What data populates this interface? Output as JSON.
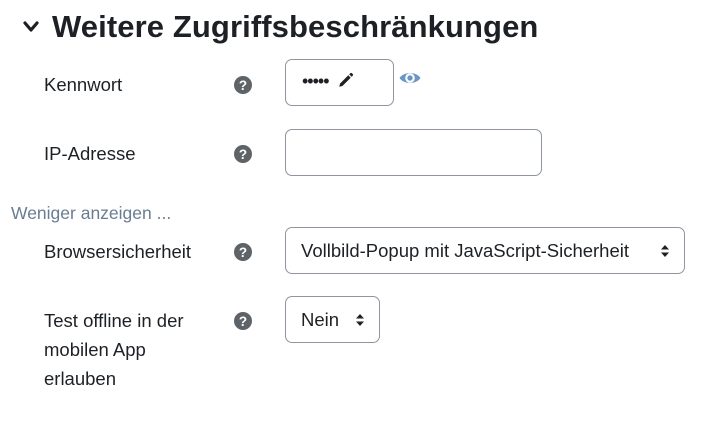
{
  "section": {
    "title": "Weitere Zugriffsbeschränkungen",
    "icon": "chevron-down-icon"
  },
  "fields": {
    "password": {
      "label": "Kennwort",
      "value": "•••••",
      "edit_icon": "pencil-icon",
      "reveal_icon": "eye-icon"
    },
    "ip": {
      "label": "IP-Adresse",
      "value": ""
    },
    "browser_security": {
      "label": "Browsersicherheit",
      "value": "Vollbild-Popup mit JavaScript-Sicherheit"
    },
    "offline": {
      "label_lines": [
        "Test offline in der",
        "mobilen App",
        "erlauben"
      ],
      "value": "Nein"
    }
  },
  "show_less_link": "Weniger anzeigen ...",
  "help_icon": "question-circle-icon",
  "colors": {
    "text": "#1d2125",
    "help_icon": "#5e6368",
    "link": "#6a7c92",
    "eye_icon": "#6b96c4",
    "border": "#8f959e"
  }
}
